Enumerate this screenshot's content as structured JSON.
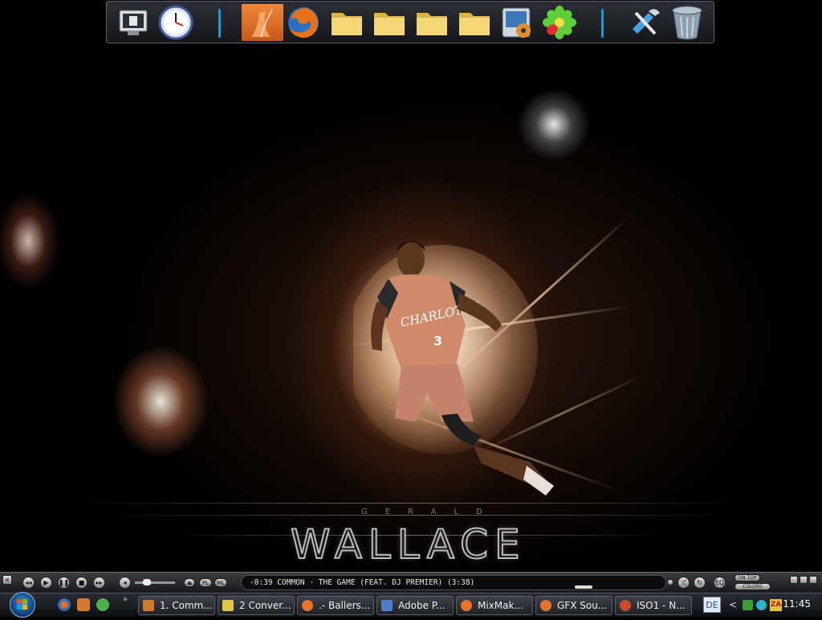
{
  "wallpaper": {
    "name_text": "WALLACE",
    "first_name_text": "GERALD",
    "jersey_text": "CHARLOTTE",
    "jersey_number": "3"
  },
  "dock": {
    "items": [
      {
        "name": "display-settings-icon"
      },
      {
        "name": "clock-icon"
      },
      {
        "name": "flash-icon"
      },
      {
        "name": "firefox-icon"
      },
      {
        "name": "folder-icon"
      },
      {
        "name": "folder-icon"
      },
      {
        "name": "folder-icon"
      },
      {
        "name": "folder-icon"
      },
      {
        "name": "media-player-icon"
      },
      {
        "name": "icq-icon"
      },
      {
        "name": "tools-icon"
      },
      {
        "name": "recycle-bin-icon"
      }
    ]
  },
  "player": {
    "now_playing": "-0:39  COMMON - THE GAME (FEAT. DJ PREMIER) (3:38)",
    "pl_label": "PL",
    "ml_label": "ML",
    "eq_label": "EQ",
    "on_top_label": "ON TOP",
    "colors_label": "COLORS"
  },
  "taskbar": {
    "items": [
      {
        "label": "1. Comm...",
        "icon": "winamp-icon",
        "color": "#d07a2a"
      },
      {
        "label": "2 Conver...",
        "icon": "folder-icon",
        "color": "#e3c545"
      },
      {
        "label": ".- Ballers...",
        "icon": "firefox-icon",
        "color": "#e8742a"
      },
      {
        "label": "Adobe P...",
        "icon": "photoshop-icon",
        "color": "#4d7fc6"
      },
      {
        "label": "MixMak...",
        "icon": "firefox-icon",
        "color": "#e8742a"
      },
      {
        "label": "GFX Sou...",
        "icon": "firefox-icon",
        "color": "#e8742a"
      },
      {
        "label": "ISO1 - N...",
        "icon": "msn-icon",
        "color": "#cf4a2b"
      }
    ],
    "language": "DE",
    "clock": "11:45",
    "chevron": "<"
  }
}
